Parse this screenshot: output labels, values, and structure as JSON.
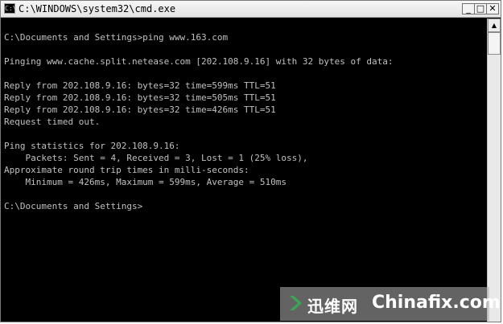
{
  "window": {
    "title": "C:\\WINDOWS\\system32\\cmd.exe",
    "icon_label": "C:\\",
    "buttons": {
      "minimize": "_",
      "maximize": "□",
      "close": "✕"
    }
  },
  "console": {
    "lines": [
      "C:\\Documents and Settings>ping www.163.com",
      "Pinging www.cache.split.netease.com [202.108.9.16] with 32 bytes of data:",
      "Reply from 202.108.9.16: bytes=32 time=599ms TTL=51",
      "Reply from 202.108.9.16: bytes=32 time=505ms TTL=51",
      "Reply from 202.108.9.16: bytes=32 time=426ms TTL=51",
      "Request timed out.",
      "Ping statistics for 202.108.9.16:",
      "    Packets: Sent = 4, Received = 3, Lost = 1 (25% loss),",
      "Approximate round trip times in milli-seconds:",
      "    Minimum = 426ms, Maximum = 599ms, Average = 510ms",
      "C:\\Documents and Settings>"
    ]
  },
  "scrollbar": {
    "up_arrow": "▲"
  },
  "watermark": {
    "chinese": "迅维网",
    "english": "Chinafix.com"
  },
  "colors": {
    "console_bg": "#000000",
    "console_text": "#c0c0c0",
    "watermark_icon": "#3aa655"
  }
}
